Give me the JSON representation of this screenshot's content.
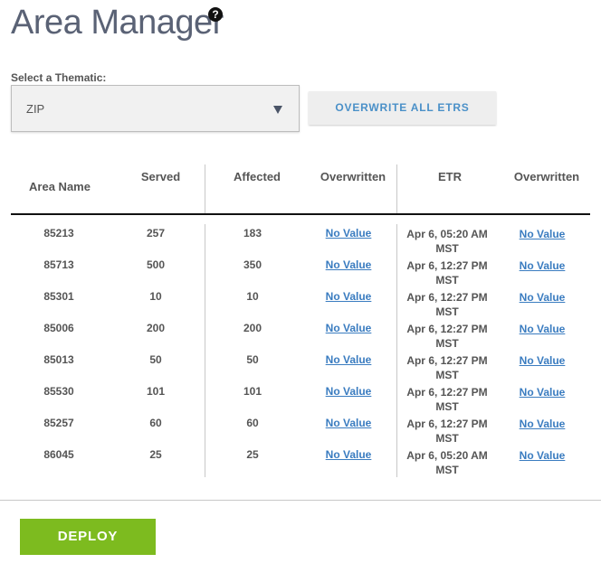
{
  "page": {
    "title": "Area Manager",
    "help_icon": "help-icon"
  },
  "thematic": {
    "label": "Select a Thematic:",
    "selected": "ZIP"
  },
  "toolbar": {
    "overwrite_label": "OVERWRITE ALL ETRS",
    "deploy_label": "DEPLOY"
  },
  "table": {
    "columns": [
      "Area Name",
      "Served",
      "Affected",
      "Overwritten",
      "ETR",
      "Overwritten"
    ],
    "rows": [
      {
        "area": "85213",
        "served": "257",
        "affected": "183",
        "overwritten": "No Value",
        "etr_1": "Apr 6, 05:20 AM",
        "etr_2": "MST",
        "etr_overwritten": "No Value"
      },
      {
        "area": "85713",
        "served": "500",
        "affected": "350",
        "overwritten": "No Value",
        "etr_1": "Apr 6, 12:27 PM",
        "etr_2": "MST",
        "etr_overwritten": "No Value"
      },
      {
        "area": "85301",
        "served": "10",
        "affected": "10",
        "overwritten": "No Value",
        "etr_1": "Apr 6, 12:27 PM",
        "etr_2": "MST",
        "etr_overwritten": "No Value"
      },
      {
        "area": "85006",
        "served": "200",
        "affected": "200",
        "overwritten": "No Value",
        "etr_1": "Apr 6, 12:27 PM",
        "etr_2": "MST",
        "etr_overwritten": "No Value"
      },
      {
        "area": "85013",
        "served": "50",
        "affected": "50",
        "overwritten": "No Value",
        "etr_1": "Apr 6, 12:27 PM",
        "etr_2": "MST",
        "etr_overwritten": "No Value"
      },
      {
        "area": "85530",
        "served": "101",
        "affected": "101",
        "overwritten": "No Value",
        "etr_1": "Apr 6, 12:27 PM",
        "etr_2": "MST",
        "etr_overwritten": "No Value"
      },
      {
        "area": "85257",
        "served": "60",
        "affected": "60",
        "overwritten": "No Value",
        "etr_1": "Apr 6, 12:27 PM",
        "etr_2": "MST",
        "etr_overwritten": "No Value"
      },
      {
        "area": "86045",
        "served": "25",
        "affected": "25",
        "overwritten": "No Value",
        "etr_1": "Apr 6, 05:20 AM",
        "etr_2": "MST",
        "etr_overwritten": "No Value"
      }
    ]
  },
  "colors": {
    "title": "#5a6275",
    "link": "#3a7cc0",
    "deploy": "#7dbb1f",
    "accent": "#4a90c8"
  }
}
